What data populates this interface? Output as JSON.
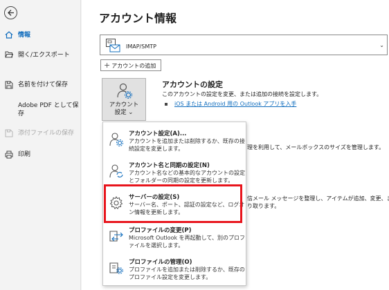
{
  "sidebar": {
    "items": [
      {
        "label": "情報",
        "icon": "home-icon"
      },
      {
        "label": "開く/エクスポート",
        "icon": "folder-open-icon"
      },
      {
        "label": "名前を付けて保存",
        "icon": "save-as-icon"
      },
      {
        "label": "Adobe PDF として保存",
        "icon": "none"
      },
      {
        "label": "添付ファイルの保存",
        "icon": "attachment-save-icon"
      },
      {
        "label": "印刷",
        "icon": "printer-icon"
      }
    ]
  },
  "main": {
    "title": "アカウント情報",
    "account_type": "IMAP/SMTP",
    "add_account_label": "アカウントの追加",
    "settings_button_label_line1": "アカウント",
    "settings_button_label_line2": "設定 ⌄",
    "section_title": "アカウントの設定",
    "section_desc": "このアカウントの設定を変更、または追加の接続を設定します。",
    "app_link": "iOS または Android 用の Outlook アプリを入手",
    "bg_text_1": "理を利用して、メールボックスのサイズを管理します。",
    "bg_text_2": "信メール メッセージを整理し、アイテムが追加、変更、ま",
    "bg_text_3": "り取ります。"
  },
  "dropdown": {
    "items": [
      {
        "title": "アカウント設定(A)...",
        "desc": "アカウントを追加または削除するか、既存の接続設定を変更します。",
        "icon": "account-settings-icon"
      },
      {
        "title": "アカウント名と同期の設定(N)",
        "desc": "アカウント名などの基本的なアカウントの設定とフォルダーの同期の設定を更新します。",
        "icon": "account-sync-icon"
      },
      {
        "title": "サーバーの設定(S)",
        "desc": "サーバー名、ポート、認証の設定など、ログオン情報を更新します。",
        "icon": "gear-icon"
      },
      {
        "title": "プロファイルの変更(P)",
        "desc": "Microsoft Outlook を再起動して、別のプロファイルを選択します。",
        "icon": "change-profile-icon"
      },
      {
        "title": "プロファイルの管理(O)",
        "desc": "プロファイルを追加または削除するか、既存のプロファイル設定を変更します。",
        "icon": "manage-profile-icon"
      }
    ]
  },
  "colors": {
    "accent": "#0f6cbd",
    "highlight": "#e8141c"
  }
}
